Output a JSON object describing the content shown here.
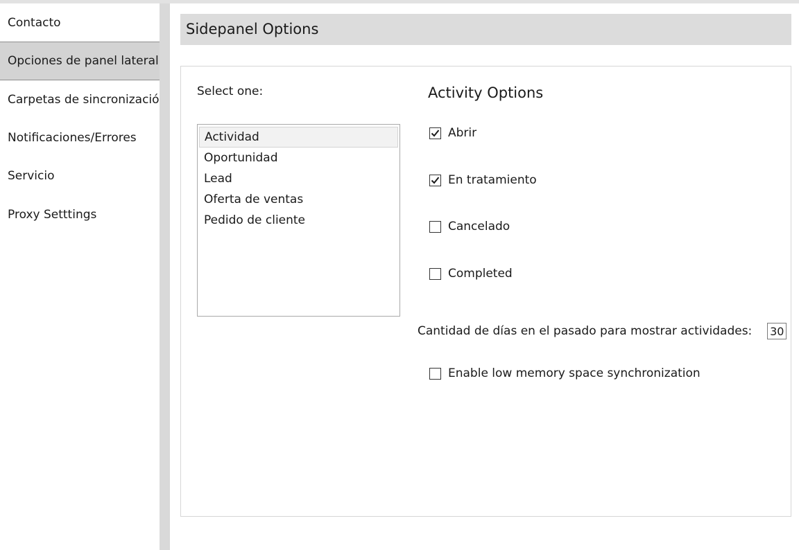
{
  "sidebar": {
    "items": [
      {
        "label": "Contacto"
      },
      {
        "label": "Opciones de panel lateral"
      },
      {
        "label": "Carpetas de sincronización"
      },
      {
        "label": "Notificaciones/Errores"
      },
      {
        "label": "Servicio"
      },
      {
        "label": "Proxy Setttings"
      }
    ],
    "selected_index": 1
  },
  "header": {
    "title": "Sidepanel Options"
  },
  "main": {
    "select_label": "Select one:",
    "list": [
      {
        "label": "Actividad"
      },
      {
        "label": "Oportunidad"
      },
      {
        "label": "Lead"
      },
      {
        "label": "Oferta de ventas"
      },
      {
        "label": "Pedido de cliente"
      }
    ],
    "selected_list_index": 0,
    "activity": {
      "title": "Activity Options",
      "options": [
        {
          "label": "Abrir",
          "checked": true
        },
        {
          "label": "En tratamiento",
          "checked": true
        },
        {
          "label": "Cancelado",
          "checked": false
        },
        {
          "label": "Completed",
          "checked": false
        }
      ]
    },
    "days": {
      "label": "Cantidad de días en el pasado para mostrar actividades:",
      "value": "30"
    },
    "low_memory": {
      "label": "Enable low memory space synchronization",
      "checked": false
    }
  }
}
